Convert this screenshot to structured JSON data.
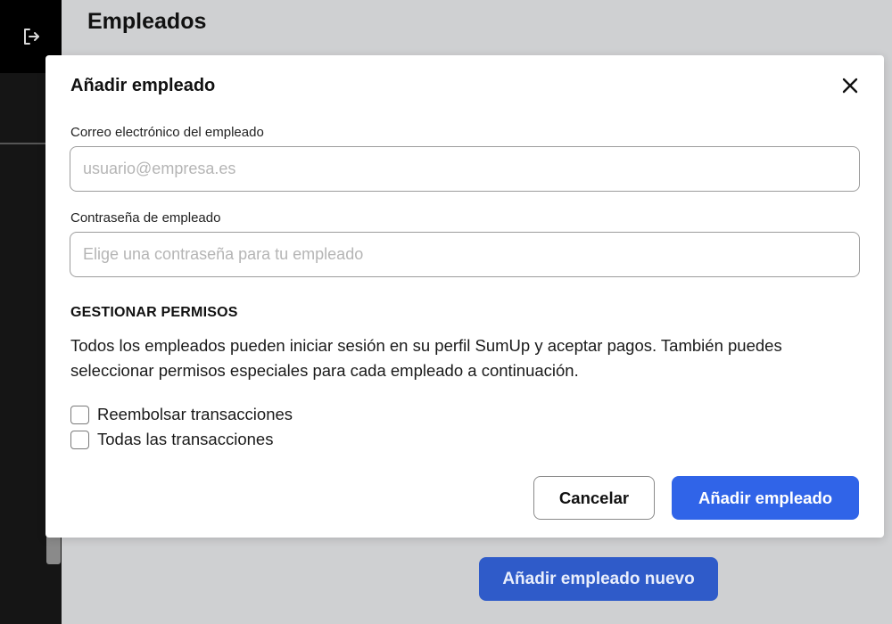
{
  "page": {
    "title": "Empleados",
    "add_new_label": "Añadir empleado nuevo"
  },
  "sidebar": {
    "icon": "logout-icon"
  },
  "modal": {
    "title": "Añadir empleado",
    "close_icon": "close-icon",
    "email": {
      "label": "Correo electrónico del empleado",
      "placeholder": "usuario@empresa.es",
      "value": ""
    },
    "password": {
      "label": "Contraseña de empleado",
      "placeholder": "Elige una contraseña para tu empleado",
      "value": ""
    },
    "permissions": {
      "title": "GESTIONAR PERMISOS",
      "description": "Todos los empleados pueden iniciar sesión en su perfil SumUp y aceptar pagos. También puedes seleccionar permisos especiales para cada empleado a continuación.",
      "options": [
        {
          "label": "Reembolsar transacciones",
          "checked": false
        },
        {
          "label": "Todas las transacciones",
          "checked": false
        }
      ]
    },
    "cancel_label": "Cancelar",
    "submit_label": "Añadir empleado"
  },
  "colors": {
    "primary": "#3064e8",
    "sidebar": "#151515",
    "backdrop": "#cfd0d2"
  }
}
